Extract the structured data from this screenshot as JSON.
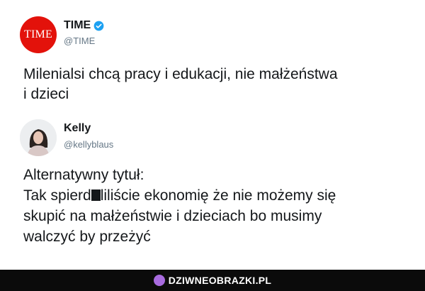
{
  "tweet1": {
    "avatar_text": "TIME",
    "name": "TIME",
    "handle": "@TIME",
    "text_lines": [
      "Milenialsi chcą pracy i edukacji, nie małżeństwa",
      "i dzieci"
    ]
  },
  "tweet2": {
    "name": "Kelly",
    "handle": "@kellyblaus",
    "line1": "Alternatywny tytuł:",
    "line2_before": "Tak spierd",
    "line2_after": "liliście ekonomię że nie możemy się",
    "line3": "skupić na małżeństwie i dzieciach bo musimy",
    "line4": "walczyć by przeżyć"
  },
  "footer": {
    "brand": "DZIWNEOBRAZKI.PL",
    "icon": "brand-logo-icon"
  },
  "colors": {
    "time_red": "#e3120b",
    "verified_blue": "#1da1f2",
    "handle_gray": "#657786",
    "footer_bg": "#0b0b0b"
  }
}
